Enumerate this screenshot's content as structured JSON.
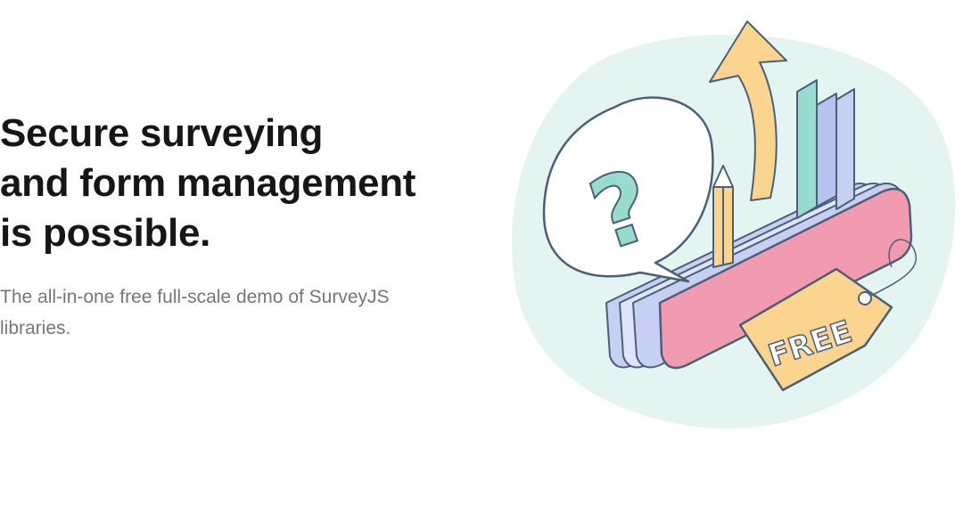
{
  "hero": {
    "headline": [
      "Secure surveying",
      "and form management",
      "is possible."
    ],
    "subtitle": "The all-in-one free full-scale demo of SurveyJS libraries.",
    "illustration": {
      "tag_text": "FREE",
      "question_glyph": "?",
      "icons": [
        "question-bubble-icon",
        "pencil-icon",
        "arrow-up-icon",
        "bar-chart-icon",
        "price-tag-icon"
      ]
    }
  },
  "colors": {
    "headline": "#161616",
    "subtitle": "#767676",
    "blob": "#e4f4f1",
    "outline": "#4b6077",
    "pink": "#f29bb0",
    "lavender": "#c7cff2",
    "teal": "#97dccf",
    "yellow": "#fbd58f"
  }
}
